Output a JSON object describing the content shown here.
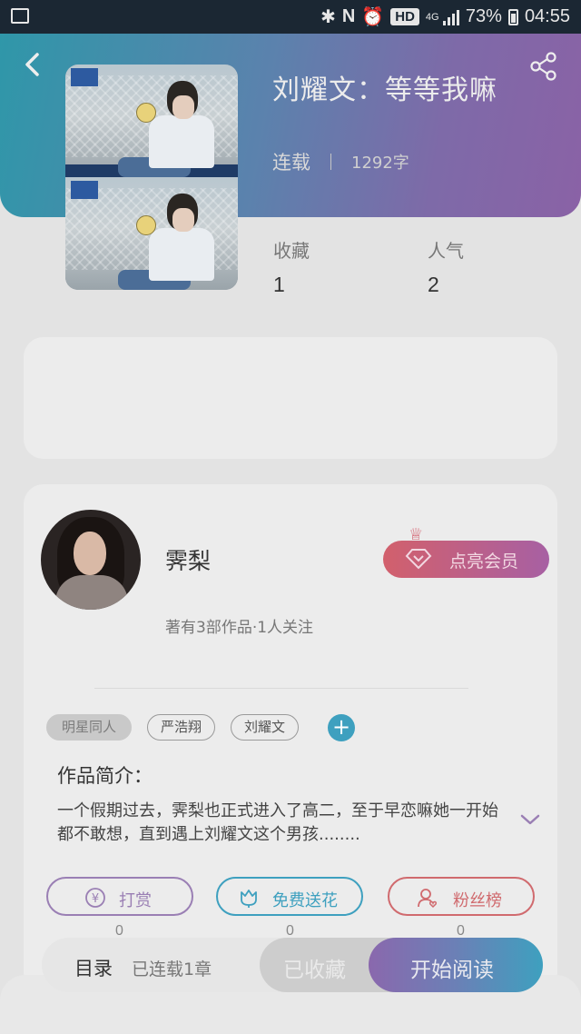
{
  "status_bar": {
    "battery": "73%",
    "time": "04:55",
    "network": "4G",
    "hd": "HD",
    "icons": [
      "image-icon",
      "bluetooth-icon",
      "nfc-icon",
      "alarm-icon",
      "signal-icon",
      "battery-icon"
    ]
  },
  "header": {
    "back_icon": "chevron-left-icon",
    "share_icon": "share-icon",
    "title": "刘耀文：等等我嘛",
    "status": "连载",
    "word_count": "1292字"
  },
  "stats": {
    "favorites_label": "收藏",
    "favorites_value": "1",
    "popularity_label": "人气",
    "popularity_value": "2"
  },
  "author": {
    "name": "霁梨",
    "info": "著有3部作品·1人关注",
    "vip_label": "点亮会员"
  },
  "tags": [
    "明星同人",
    "严浩翔",
    "刘耀文"
  ],
  "tag_add": "+",
  "intro": {
    "heading": "作品简介：",
    "text": "一个假期过去，霁梨也正式进入了高二，至于早恋嘛她一开始都不敢想，直到遇上刘耀文这个男孩........"
  },
  "actions": [
    {
      "label": "打赏",
      "count": "0",
      "icon": "yen-icon"
    },
    {
      "label": "免费送花",
      "count": "0",
      "icon": "flower-icon"
    },
    {
      "label": "粉丝榜",
      "count": "0",
      "icon": "fans-icon"
    }
  ],
  "bottom_bar": {
    "toc": "目录",
    "serial": "已连载1章",
    "favorited": "已收藏",
    "start_reading": "开始阅读"
  },
  "colors": {
    "header_gradient_start": "#2f97a9",
    "header_gradient_end": "#8a62a6",
    "accent_cyan": "#3ea0bf",
    "accent_purple": "#9a7fb4",
    "accent_red": "#d06a6e"
  }
}
